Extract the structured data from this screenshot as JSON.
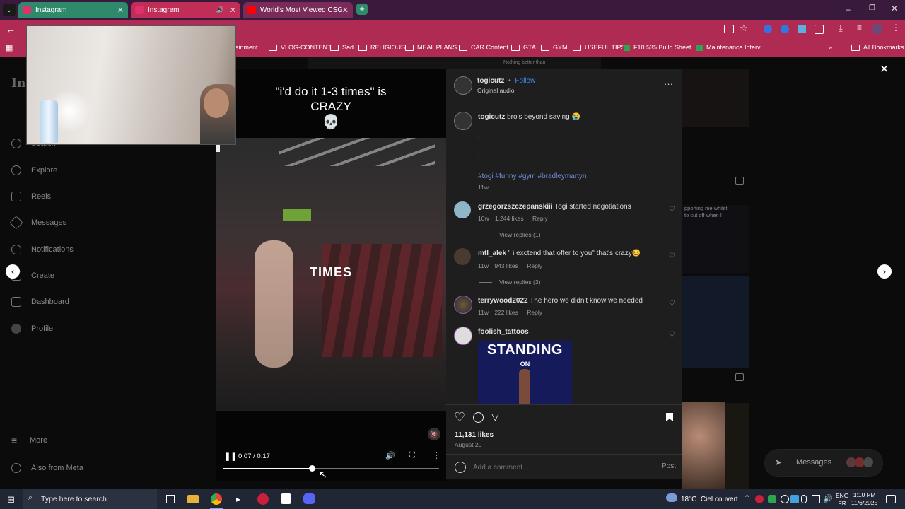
{
  "browser": {
    "tabs": [
      {
        "title": "Instagram",
        "active": false
      },
      {
        "title": "Instagram",
        "active": true
      },
      {
        "title": "World's Most Viewed CSGO Cl",
        "active": false
      }
    ],
    "bookmarks": [
      "tainment",
      "VLOG-CONTENT",
      "Sad",
      "RELIGIOUS",
      "MEAL PLANS",
      "CAR Content",
      "GTA",
      "GYM",
      "USEFUL TIPS",
      "F10 535 Build Sheet...",
      "Maintenance Interv..."
    ],
    "all_bookmarks": "All Bookmarks"
  },
  "instagram": {
    "nav": [
      {
        "label": "Search"
      },
      {
        "label": "Explore"
      },
      {
        "label": "Reels"
      },
      {
        "label": "Messages"
      },
      {
        "label": "Notifications"
      },
      {
        "label": "Create"
      },
      {
        "label": "Dashboard"
      },
      {
        "label": "Profile"
      }
    ],
    "more": "More",
    "also_from_meta": "Also from Meta",
    "messages_pill": "Messages",
    "bg_text": "Nothing better than",
    "bg_side_text": "pporting me whilst\nto cut off when I"
  },
  "video": {
    "caption_line1": "\"i'd do it 1-3 times\" is",
    "caption_line2": "CRAZY",
    "overlay_word": "TIMES",
    "time": "0:07 / 0:17",
    "progress": 0.41
  },
  "post": {
    "username": "togicutz",
    "follow": "Follow",
    "audio": "Original audio",
    "caption_user": "togicutz",
    "caption_text": "bro's beyond saving 😭",
    "dots": [
      ".",
      ".",
      ".",
      ".",
      "."
    ],
    "hashtags": "#togi #funny #gym #bradleymartyn",
    "caption_age": "11w",
    "comments": [
      {
        "user": "grzegorzszczepanskiii",
        "text": "Togi started negotiations",
        "age": "10w",
        "likes": "1,244 likes",
        "reply": "Reply",
        "view_replies": "View replies (1)"
      },
      {
        "user": "mtl_alek",
        "text": "\" i exctend that offer to you\" that's crazy😆",
        "age": "11w",
        "likes": "943 likes",
        "reply": "Reply",
        "view_replies": "View replies (3)"
      },
      {
        "user": "terrywood2022",
        "text": "The hero we didn't know we needed",
        "age": "11w",
        "likes": "222 likes",
        "reply": "Reply"
      },
      {
        "user": "foolish_tattoos",
        "gif_top": "STANDING",
        "gif_bottom": "ON"
      }
    ],
    "likes": "11,131 likes",
    "date": "August 20",
    "add_comment_placeholder": "Add a comment...",
    "post_button": "Post"
  },
  "taskbar": {
    "search_placeholder": "Type here to search",
    "weather": "18°C  Ciel couvert",
    "lang_top": "ENG",
    "lang_bottom": "FR",
    "time": "1:10 PM",
    "date": "11/6/2025"
  }
}
